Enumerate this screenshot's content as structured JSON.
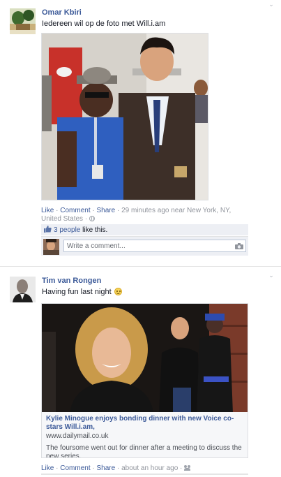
{
  "feed": {
    "posts": [
      {
        "author": "Omar Kbiri",
        "status": "Iedereen wil op de foto met Will.i.am",
        "actions": {
          "like": "Like",
          "comment": "Comment",
          "share": "Share",
          "time": "29 minutes ago",
          "location_prefix": "near",
          "location": "New York, NY, United States",
          "privacy_icon": "globe-icon"
        },
        "likes": {
          "count_link": "3 people",
          "suffix": "like this."
        },
        "comment_box": {
          "placeholder": "Write a comment...",
          "icon": "camera-icon"
        }
      },
      {
        "author": "Tim van Rongen",
        "status": "Having fun last night",
        "emoticon": "smiley-icon",
        "link": {
          "title": "Kylie Minogue enjoys bonding dinner with new Voice co-stars Will.i.am,",
          "domain": "www.dailymail.co.uk",
          "description": "The foursome went out for dinner after a meeting to discuss the new series."
        },
        "actions": {
          "like": "Like",
          "comment": "Comment",
          "share": "Share",
          "time": "about an hour ago",
          "privacy_icon": "friends-icon"
        }
      }
    ]
  },
  "colors": {
    "link": "#3b5998",
    "ufi_background": "#edeff4",
    "meta_text": "#90949c"
  }
}
